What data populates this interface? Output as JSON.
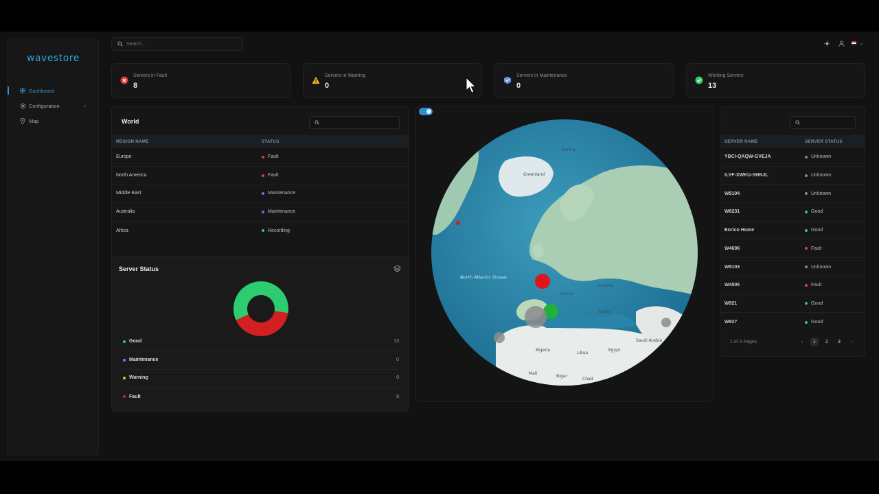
{
  "app": {
    "logo": "wavestore"
  },
  "sidebar": {
    "items": [
      {
        "label": "Dashboard",
        "icon": "dashboard-icon",
        "active": true
      },
      {
        "label": "Configuration",
        "icon": "gear-icon",
        "has_children": true
      },
      {
        "label": "Map",
        "icon": "map-pin-icon"
      }
    ]
  },
  "search": {
    "placeholder": "Search..."
  },
  "kpis": [
    {
      "label": "Servers in Fault",
      "value": "8",
      "icon": "error-icon",
      "color": "#e23b3b"
    },
    {
      "label": "Servers in Warning",
      "value": "0",
      "icon": "warning-icon",
      "color": "#f0b429"
    },
    {
      "label": "Servers in Maintenance",
      "value": "0",
      "icon": "maintenance-icon",
      "color": "#6f8fe0"
    },
    {
      "label": "Working Servers",
      "value": "13",
      "icon": "check-icon",
      "color": "#3cc86b"
    }
  ],
  "world": {
    "title": "World",
    "columns": [
      "REGION NAME",
      "STATUS"
    ],
    "rows": [
      {
        "region": "Europe",
        "status": "Fault",
        "color": "#e23b4f"
      },
      {
        "region": "North America",
        "status": "Fault",
        "color": "#e23b4f"
      },
      {
        "region": "Middle East",
        "status": "Maintenance",
        "color": "#5b7fd6"
      },
      {
        "region": "Australia",
        "status": "Maintenance",
        "color": "#5b7fd6"
      },
      {
        "region": "Africa",
        "status": "Recording",
        "color": "#3cc86b"
      }
    ]
  },
  "server_status": {
    "title": "Server Status",
    "legend": [
      {
        "label": "Good",
        "value": "13",
        "color": "#2ecc71"
      },
      {
        "label": "Maintenance",
        "value": "0",
        "color": "#6f7fe0"
      },
      {
        "label": "Warning",
        "value": "0",
        "color": "#e8c12a"
      },
      {
        "label": "Fault",
        "value": "8",
        "color": "#d31f1f"
      }
    ]
  },
  "servers": {
    "columns": [
      "SERVER NAME",
      "SERVER STATUS"
    ],
    "rows": [
      {
        "name": "YBCI-QAQW-GVEJA",
        "status": "Unknown",
        "color": "#8a8a8a"
      },
      {
        "name": "ILYF-XWKU-SHNJL",
        "status": "Unknown",
        "color": "#8a8a8a"
      },
      {
        "name": "W9104",
        "status": "Unknown",
        "color": "#8a8a8a"
      },
      {
        "name": "W8231",
        "status": "Good",
        "color": "#2ecc71"
      },
      {
        "name": "Enrico Home",
        "status": "Good",
        "color": "#2ecc71"
      },
      {
        "name": "W4696",
        "status": "Fault",
        "color": "#e23b4f"
      },
      {
        "name": "W9103",
        "status": "Unknown",
        "color": "#8a8a8a"
      },
      {
        "name": "W4505",
        "status": "Fault",
        "color": "#e23b4f"
      },
      {
        "name": "W921",
        "status": "Good",
        "color": "#2ecc71"
      },
      {
        "name": "W927",
        "status": "Good",
        "color": "#2ecc71"
      }
    ],
    "pagination": {
      "summary": "1 of 3 Pages",
      "pages": [
        "1",
        "2",
        "3"
      ],
      "current": "1"
    }
  },
  "globe": {
    "labels": [
      "Greenland",
      "North Atlantic Ocean",
      "France",
      "Algeria",
      "Libya",
      "Egypt",
      "Mali",
      "Niger",
      "Chad",
      "Saudi Arabia",
      "Turkey",
      "Ukraine",
      "Bering"
    ]
  },
  "colors": {
    "accent": "#2b8fd0",
    "background": "#121212",
    "panel": "#161616"
  }
}
